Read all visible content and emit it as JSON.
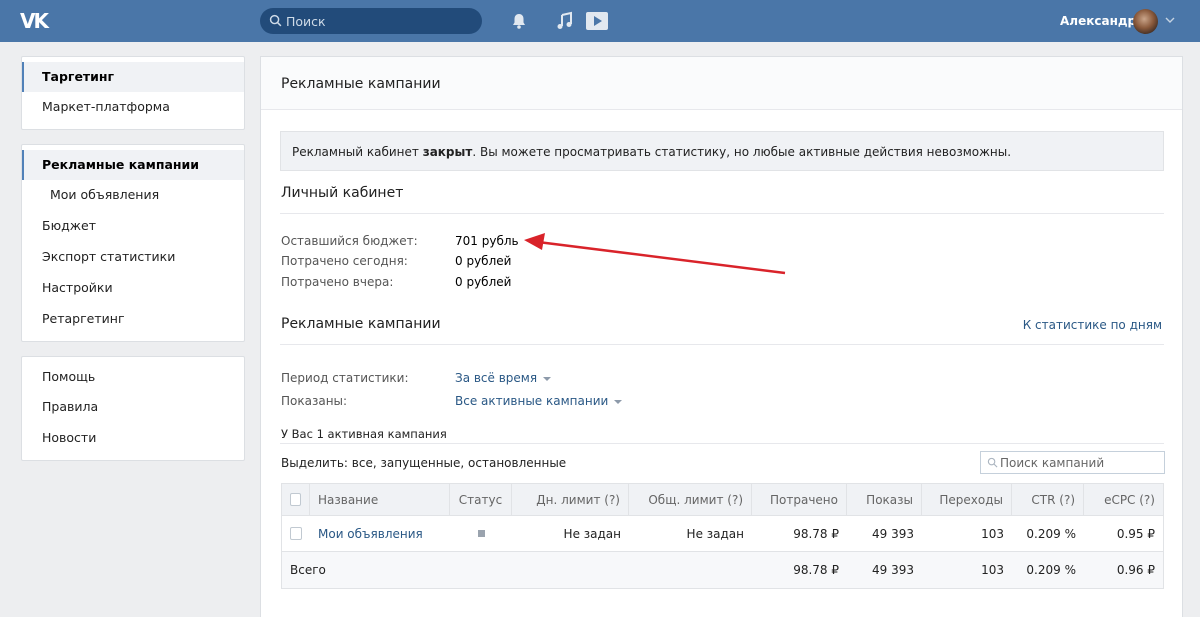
{
  "header": {
    "logo": "VK",
    "search_placeholder": "Поиск",
    "user_name": "Александр"
  },
  "sidebar": {
    "group1": [
      {
        "label": "Таргетинг",
        "active": true
      },
      {
        "label": "Маркет-платформа",
        "active": false
      }
    ],
    "group2": [
      {
        "label": "Рекламные кампании",
        "active": true
      },
      {
        "label": "Мои объявления",
        "active": false
      },
      {
        "label": "Бюджет",
        "active": false
      },
      {
        "label": "Экспорт статистики",
        "active": false
      },
      {
        "label": "Настройки",
        "active": false
      },
      {
        "label": "Ретаргетинг",
        "active": false
      }
    ],
    "group3": [
      {
        "label": "Помощь"
      },
      {
        "label": "Правила"
      },
      {
        "label": "Новости"
      }
    ]
  },
  "main": {
    "title": "Рекламные кампании",
    "notice": {
      "prefix": "Рекламный кабинет ",
      "bold": "закрыт",
      "suffix": ". Вы можете просматривать статистику, но любые активные действия невозможны."
    },
    "account": {
      "title": "Личный кабинет",
      "rows": [
        {
          "label": "Оставшийся бюджет:",
          "value": "701 рубль"
        },
        {
          "label": "Потрачено сегодня:",
          "value": "0 рублей"
        },
        {
          "label": "Потрачено вчера:",
          "value": "0 рублей"
        }
      ]
    },
    "campaigns": {
      "title": "Рекламные кампании",
      "stats_link": "К статистике по дням",
      "period_label": "Период статистики:",
      "period_value": "За всё время",
      "shown_label": "Показаны:",
      "shown_value": "Все активные кампании",
      "active_count": "У Вас 1 активная кампания",
      "select_prefix": "Выделить: ",
      "select_all": "все",
      "select_running": "запущенные",
      "select_stopped": "остановленные",
      "search_placeholder": "Поиск кампаний"
    },
    "table": {
      "columns": [
        "Название",
        "Статус",
        "Дн. лимит (?)",
        "Общ. лимит (?)",
        "Потрачено",
        "Показы",
        "Переходы",
        "CTR (?)",
        "eCPC (?)"
      ],
      "row": {
        "name": "Мои объявления",
        "day_limit": "Не задан",
        "total_limit": "Не задан",
        "spent": "98.78 ₽",
        "impressions": "49 393",
        "clicks": "103",
        "ctr": "0.209 %",
        "ecpc": "0.95 ₽"
      },
      "total": {
        "label": "Всего",
        "spent": "98.78 ₽",
        "impressions": "49 393",
        "clicks": "103",
        "ctr": "0.209 %",
        "ecpc": "0.96 ₽"
      }
    }
  },
  "colors": {
    "header_bg": "#4a76a8",
    "link": "#2a5885",
    "arrow": "#d9232a"
  }
}
